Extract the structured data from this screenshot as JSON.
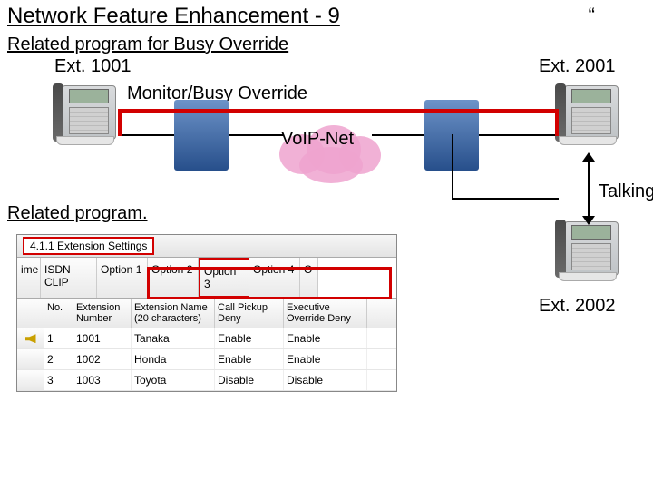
{
  "title": "Network Feature Enhancement - 9",
  "top_right": "“",
  "subtitle": "Related program for Busy Override",
  "ext1001": "Ext. 1001",
  "ext2001": "Ext. 2001",
  "monitor": "Monitor/Busy Override",
  "voip": "VoIP-Net",
  "talking": "Talking",
  "relprog": "Related program.",
  "ext2002": "Ext. 2002",
  "tab_title": "4.1.1 Extension Settings",
  "opts": {
    "ime": "ime",
    "clip": "ISDN CLIP",
    "o1": "Option 1",
    "o2": "Option 2",
    "o3": "Option 3",
    "o4": "Option 4",
    "o5": "O"
  },
  "cols": {
    "c1": "No.",
    "c2": "Extension Number",
    "c3": "Extension Name (20 characters)",
    "c4": "Call Pickup Deny",
    "c5": "Executive Override Deny"
  },
  "rows": [
    {
      "no": "1",
      "ext": "1001",
      "name": "Tanaka",
      "pickup": "Enable",
      "over": "Enable"
    },
    {
      "no": "2",
      "ext": "1002",
      "name": "Honda",
      "pickup": "Enable",
      "over": "Enable"
    },
    {
      "no": "3",
      "ext": "1003",
      "name": "Toyota",
      "pickup": "Disable",
      "over": "Disable"
    }
  ]
}
